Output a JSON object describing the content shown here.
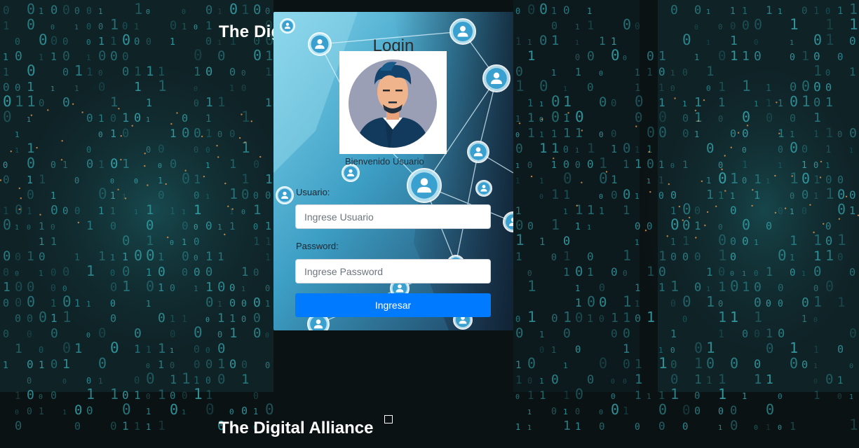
{
  "brand": {
    "name_top": "The Digi",
    "name_bottom": "The Digital Alliance"
  },
  "login": {
    "title": "Login",
    "welcome": "Bienvenido Usuario",
    "username_label": "Usuario:",
    "username_placeholder": "Ingrese Usuario",
    "password_label": "Password:",
    "password_placeholder": "Ingrese Password",
    "submit_label": "Ingresar"
  },
  "colors": {
    "accent": "#007bff",
    "background": "#0b1214",
    "digits": "#3fc1c9"
  },
  "icons": {
    "avatar": "user-avatar-icon",
    "network_node": "user-node-icon"
  }
}
